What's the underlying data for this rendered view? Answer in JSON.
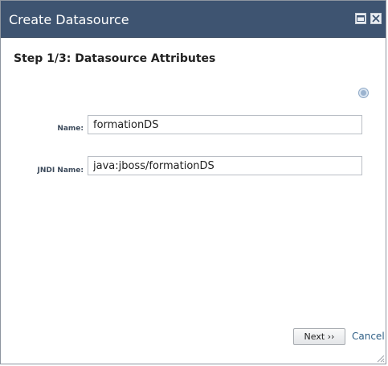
{
  "dialog": {
    "title": "Create Datasource",
    "step_title": "Step 1/3: Datasource Attributes"
  },
  "form": {
    "name_label": "Name:",
    "name_value": "formationDS",
    "jndi_label": "JNDI Name:",
    "jndi_value": "java:jboss/formationDS"
  },
  "buttons": {
    "next_label": "Next ››",
    "cancel_label": "Cancel"
  },
  "icons": {
    "maximize": "maximize-icon",
    "close": "close-icon",
    "help": "help-icon",
    "resize": "resize-grip-icon"
  },
  "colors": {
    "titlebar": "#3e5471",
    "cancel_link": "#2f5f86"
  }
}
